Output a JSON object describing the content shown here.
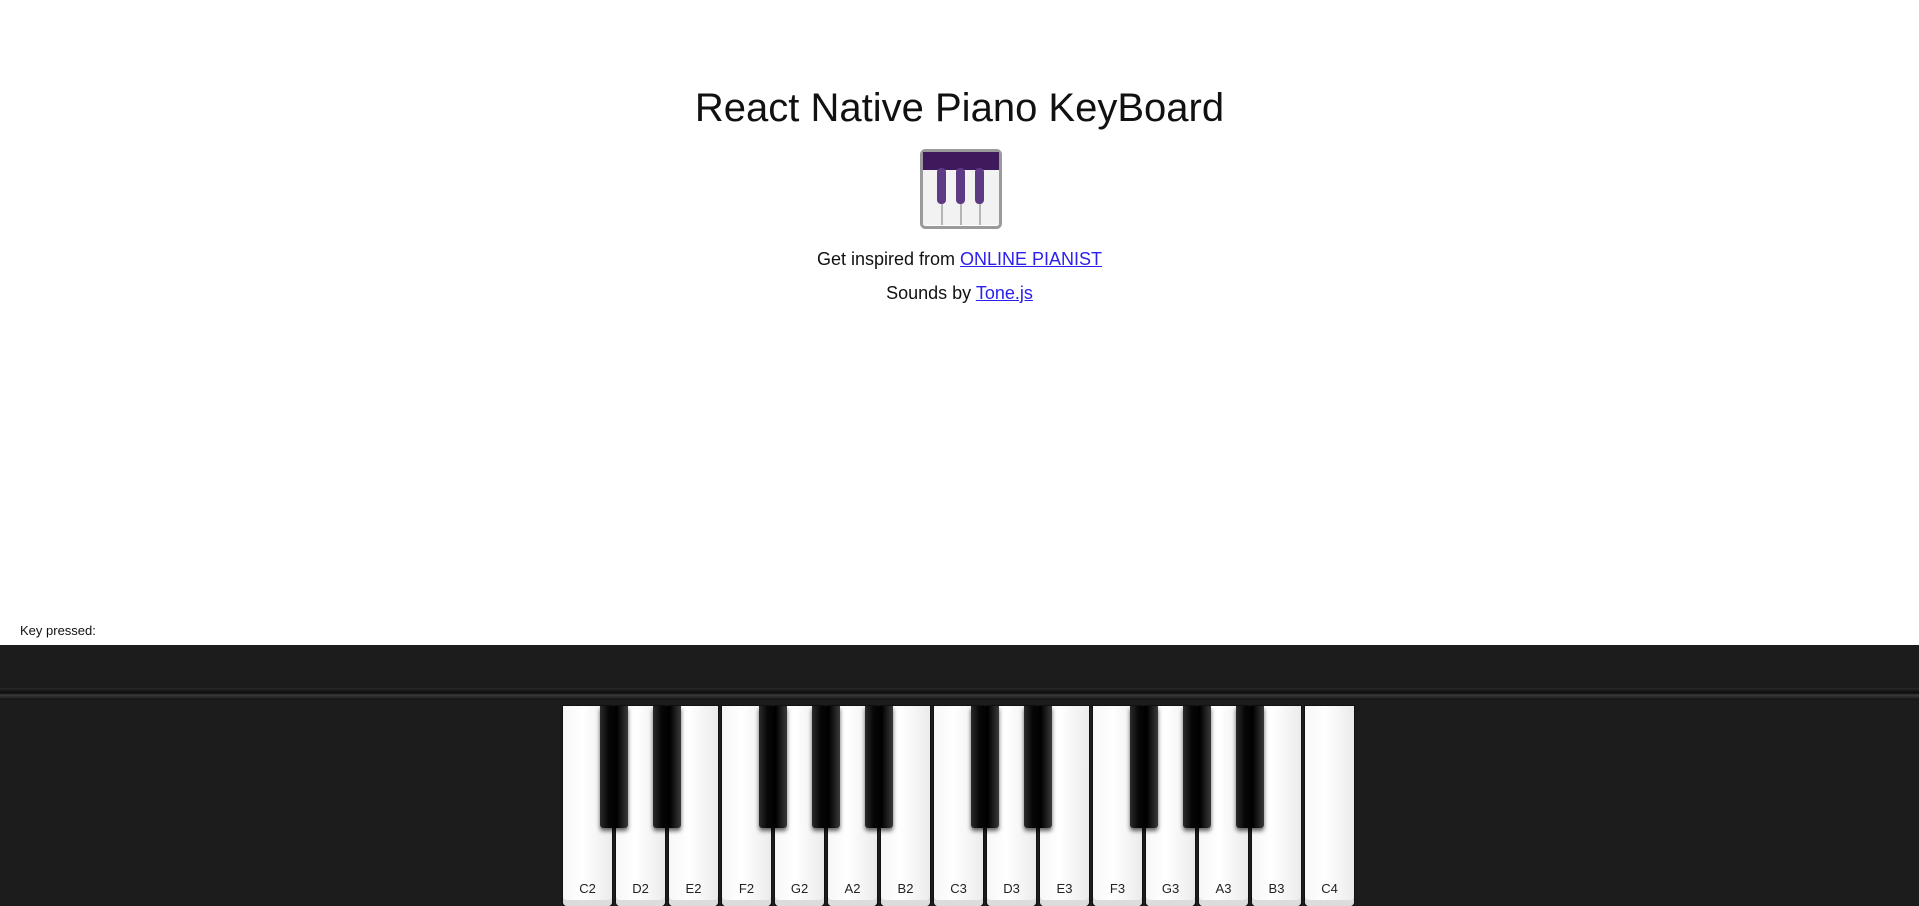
{
  "header": {
    "title": "React Native Piano KeyBoard",
    "logo_icon": "piano-icon"
  },
  "credits": {
    "inspired_prefix": "Get inspired from ",
    "inspired_link": "ONLINE PIANIST",
    "sounds_prefix": "Sounds by ",
    "sounds_link": "Tone.js"
  },
  "status": {
    "key_pressed_label": "Key pressed:",
    "key_pressed_value": ""
  },
  "keyboard": {
    "white_keys": [
      "C2",
      "D2",
      "E2",
      "F2",
      "G2",
      "A2",
      "B2",
      "C3",
      "D3",
      "E3",
      "F3",
      "G3",
      "A3",
      "B3",
      "C4"
    ],
    "black_keys": [
      "C#2",
      "D#2",
      "F#2",
      "G#2",
      "A#2",
      "C#3",
      "D#3",
      "F#3",
      "G#3",
      "A#3"
    ]
  },
  "colors": {
    "piano_bg": "#1c1c1c",
    "link": "#2a1ff0",
    "logo_purple": "#3e1a5c"
  }
}
